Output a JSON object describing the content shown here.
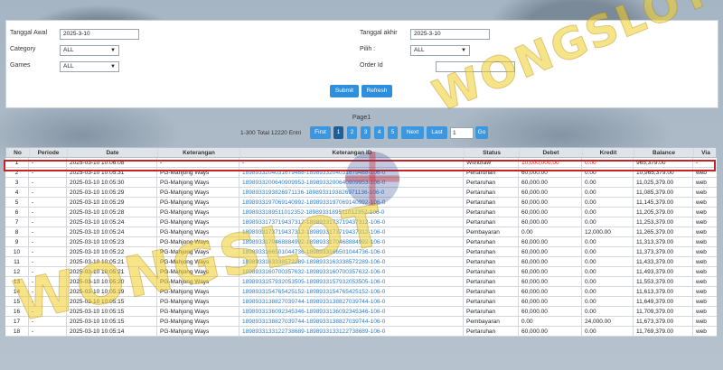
{
  "filter": {
    "tanggal_awal_label": "Tanggal Awal",
    "tanggal_awal_value": "2025-3-10",
    "category_label": "Category",
    "category_value": "ALL",
    "games_label": "Games",
    "games_value": "ALL",
    "tanggal_akhir_label": "Tanggal akhir",
    "tanggal_akhir_value": "2025-3-10",
    "pilih_label": "Pilih  :",
    "pilih_value": "ALL",
    "order_id_label": "Order Id",
    "order_id_value": "",
    "submit_label": "Submit",
    "refresh_label": "Refresh"
  },
  "pager": {
    "title": "Page1",
    "total_text": "1-300 Total 12220 Entri",
    "first": "First",
    "pages": [
      "1",
      "2",
      "3",
      "4",
      "5"
    ],
    "next": "Next",
    "last": "Last",
    "page_input": "1",
    "go": "Go"
  },
  "watermark": "WONGSLOT",
  "table": {
    "headers": [
      "No",
      "Periode",
      "Date",
      "Keterangan",
      "Keterangan ID",
      "Status",
      "Debet",
      "Kredit",
      "Balance",
      "Via"
    ],
    "rows": [
      [
        "1",
        "-",
        "2025-03-10 10:06:08",
        "-",
        "-",
        "Withdraw",
        "10,000,000.00",
        "0.00",
        "965,379.00",
        "-"
      ],
      [
        "2",
        "-",
        "2025-03-10 10:05:31",
        "PG-Mahjong Ways",
        "1898933204031679488-1898933204031679488-106-0",
        "Pertaruhan",
        "60,000.00",
        "0.00",
        "10,965,379.00",
        "web"
      ],
      [
        "3",
        "-",
        "2025-03-10 10:05:30",
        "PG-Mahjong Ways",
        "1898933200640909953-1898933200640909953-106-0",
        "Pertaruhan",
        "60,000.00",
        "0.00",
        "11,025,379.00",
        "web"
      ],
      [
        "4",
        "-",
        "2025-03-10 10:05:29",
        "PG-Mahjong Ways",
        "1898933193826971136-1898933193826971136-106-0",
        "Pertaruhan",
        "60,000.00",
        "0.00",
        "11,085,379.00",
        "web"
      ],
      [
        "5",
        "-",
        "2025-03-10 10:05:29",
        "PG-Mahjong Ways",
        "1898933197069140992-1898933197069140992-106-0",
        "Pertaruhan",
        "60,000.00",
        "0.00",
        "11,145,379.00",
        "web"
      ],
      [
        "6",
        "-",
        "2025-03-10 10:05:28",
        "PG-Mahjong Ways",
        "1898933189511012352-1898933189511012352-106-0",
        "Pertaruhan",
        "60,000.00",
        "0.00",
        "11,205,379.00",
        "web"
      ],
      [
        "7",
        "-",
        "2025-03-10 10:05:24",
        "PG-Mahjong Ways",
        "1898933173719437312-1898933173719437312-106-0",
        "Pertaruhan",
        "60,000.00",
        "0.00",
        "11,253,379.00",
        "web"
      ],
      [
        "8",
        "-",
        "2025-03-10 10:05:24",
        "PG-Mahjong Ways",
        "1898933173719437312-1898933173719437312-106-0",
        "Pembayaran",
        "0.00",
        "12,000.00",
        "11,265,379.00",
        "web"
      ],
      [
        "9",
        "-",
        "2025-03-10 10:05:23",
        "PG-Mahjong Ways",
        "1898933170468884992-1898933170468884992-106-0",
        "Pertaruhan",
        "60,000.00",
        "0.00",
        "11,313,379.00",
        "web"
      ],
      [
        "10",
        "-",
        "2025-03-10 10:05:22",
        "PG-Mahjong Ways",
        "1898933166501044736-1898933166501044736-106-0",
        "Pertaruhan",
        "60,000.00",
        "0.00",
        "11,373,379.00",
        "web"
      ],
      [
        "11",
        "-",
        "2025-03-10 10:05:21",
        "PG-Mahjong Ways",
        "1898933163338572289-1898933163338572289-106-0",
        "Pertaruhan",
        "60,000.00",
        "0.00",
        "11,433,379.00",
        "web"
      ],
      [
        "12",
        "-",
        "2025-03-10 10:05:21",
        "PG-Mahjong Ways",
        "1898933160700357632-1898933160700357632-106-0",
        "Pertaruhan",
        "60,000.00",
        "0.00",
        "11,493,379.00",
        "web"
      ],
      [
        "13",
        "-",
        "2025-03-10 10:05:20",
        "PG-Mahjong Ways",
        "1898933157932053505-1898933157932053505-106-0",
        "Pertaruhan",
        "60,000.00",
        "0.00",
        "11,553,379.00",
        "web"
      ],
      [
        "14",
        "-",
        "2025-03-10 10:05:19",
        "PG-Mahjong Ways",
        "1898933154765425152-1898933154765425152-106-0",
        "Pertaruhan",
        "60,000.00",
        "0.00",
        "11,613,379.00",
        "web"
      ],
      [
        "15",
        "-",
        "2025-03-10 10:05:15",
        "PG-Mahjong Ways",
        "1898933138827039744-1898933138827039744-106-0",
        "Pertaruhan",
        "60,000.00",
        "0.00",
        "11,649,379.00",
        "web"
      ],
      [
        "16",
        "-",
        "2025-03-10 10:05:15",
        "PG-Mahjong Ways",
        "1898933136092345346-1898933136092345346-106-0",
        "Pertaruhan",
        "60,000.00",
        "0.00",
        "11,709,379.00",
        "web"
      ],
      [
        "17",
        "-",
        "2025-03-10 10:05:15",
        "PG-Mahjong Ways",
        "1898933138827039744-1898933138827039744-106-0",
        "Pembayaran",
        "0.00",
        "24,000.00",
        "11,673,379.00",
        "web"
      ],
      [
        "18",
        "-",
        "2025-03-10 10:05:14",
        "PG-Mahjong Ways",
        "1898933133122738689-1898933133122738689-106-0",
        "Pertaruhan",
        "60,000.00",
        "0.00",
        "11,769,379.00",
        "web"
      ]
    ]
  }
}
